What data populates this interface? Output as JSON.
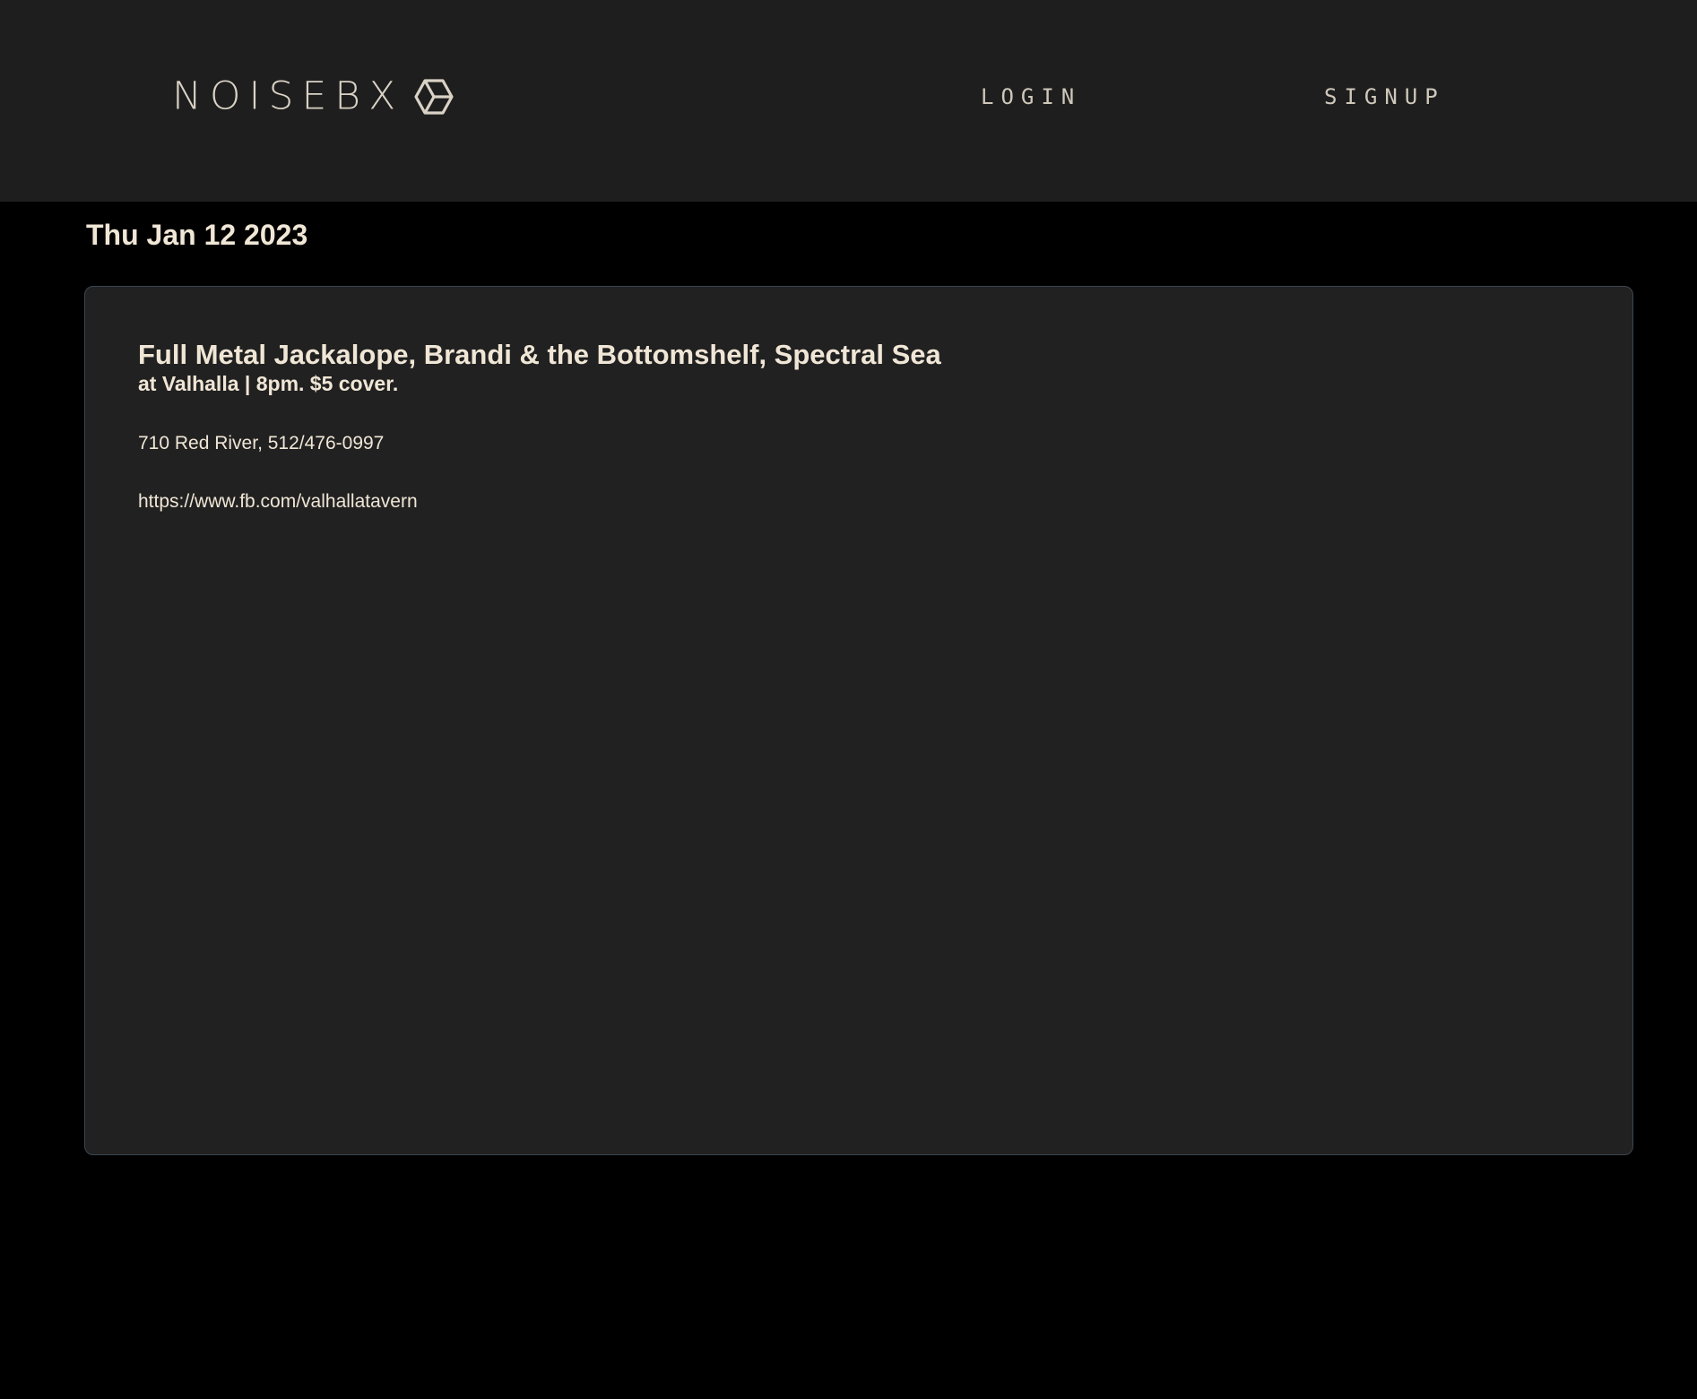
{
  "header": {
    "logo_text": "NOISEBX",
    "logo_icon": "hexagon-cube-icon",
    "nav": {
      "login_label": "LOGIN",
      "signup_label": "SIGNUP"
    }
  },
  "main": {
    "date": "Thu Jan 12 2023",
    "event": {
      "title": "Full Metal Jackalope, Brandi & the Bottomshelf, Spectral Sea",
      "subtitle": "at Valhalla | 8pm. $5 cover.",
      "address": "710 Red River, 512/476-0997",
      "link": "https://www.fb.com/valhallatavern"
    }
  },
  "colors": {
    "page_background": "#000000",
    "header_background": "#1e1e1e",
    "card_background": "#212121",
    "card_border": "#3b4650",
    "text_primary": "#f0e6d6",
    "logo_color": "#d9d2c5"
  }
}
